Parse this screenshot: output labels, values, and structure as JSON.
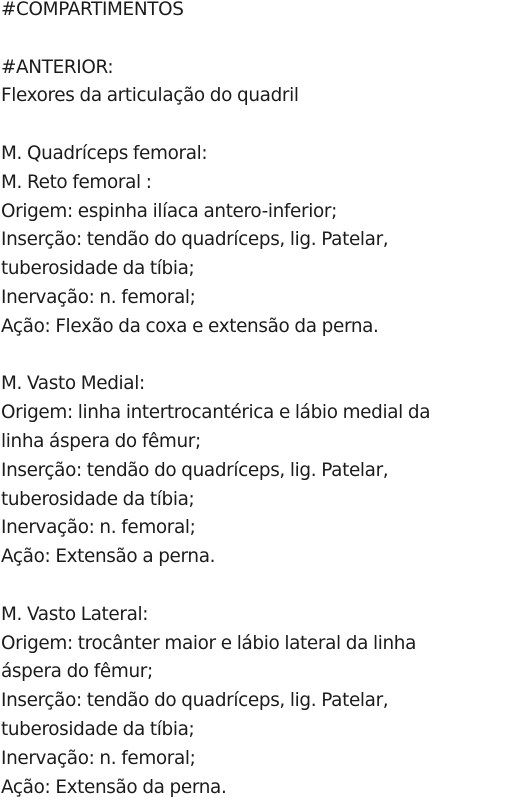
{
  "document": {
    "heading": "#COMPARTIMENTOS",
    "section": {
      "title": "#ANTERIOR:",
      "subtitle": "Flexores da articulação do quadril"
    },
    "group_title": "M. Quadríceps femoral:",
    "muscles": [
      {
        "name": "M. Reto femoral :",
        "origin": "Origem: espinha ilíaca antero-inferior;",
        "insertion_1": "Inserção: tendão do quadríceps, lig. Patelar,",
        "insertion_2": "tuberosidade da tíbia;",
        "innervation": "Inervação: n. femoral;",
        "action": "Ação: Flexão da coxa e extensão da perna."
      },
      {
        "name": "M. Vasto Medial:",
        "origin_1": "Origem: linha intertrocantérica e lábio medial da",
        "origin_2": "linha áspera do fêmur;",
        "insertion_1": "Inserção: tendão do quadríceps, lig. Patelar,",
        "insertion_2": "tuberosidade da tíbia;",
        "innervation": "Inervação: n. femoral;",
        "action": "Ação: Extensão a perna."
      },
      {
        "name": "M. Vasto Lateral:",
        "origin_1": "Origem: trocânter maior e lábio lateral da linha",
        "origin_2": "áspera do fêmur;",
        "insertion_1": "Inserção: tendão do quadríceps, lig. Patelar,",
        "insertion_2": "tuberosidade da tíbia;",
        "innervation": "Inervação: n. femoral;",
        "action": "Ação: Extensão da perna."
      }
    ]
  }
}
